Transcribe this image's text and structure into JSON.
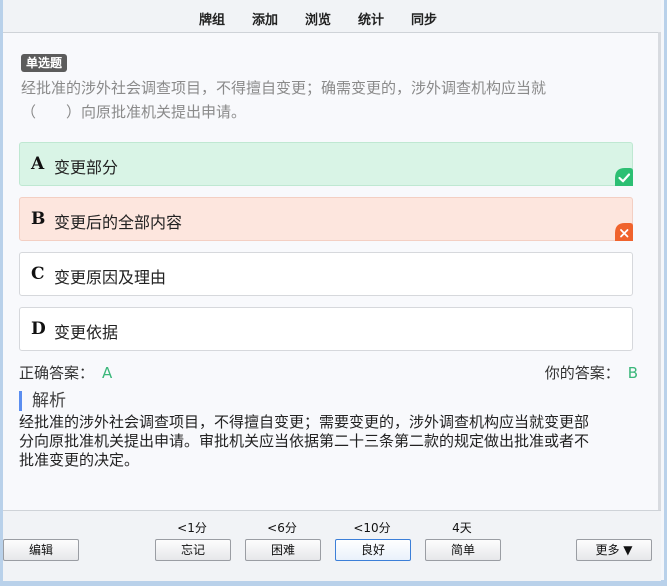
{
  "nav": {
    "tabs": [
      "牌组",
      "添加",
      "浏览",
      "统计",
      "同步"
    ]
  },
  "question": {
    "type_badge": "单选题",
    "line1": "经批准的涉外社会调查项目，不得擅自变更；确需变更的，涉外调查机构应当就",
    "line2": "（　　）向原批准机关提出申请。"
  },
  "options": [
    {
      "letter": "A",
      "text": "变更部分",
      "state": "correct"
    },
    {
      "letter": "B",
      "text": "变更后的全部内容",
      "state": "wrong"
    },
    {
      "letter": "C",
      "text": "变更原因及理由",
      "state": "normal"
    },
    {
      "letter": "D",
      "text": "变更依据",
      "state": "normal"
    }
  ],
  "answers": {
    "correct_label": "正确答案：",
    "correct_value": "A",
    "yours_label": "你的答案：",
    "yours_value": "B"
  },
  "analysis": {
    "heading": "解析",
    "line1": "经批准的涉外社会调查项目，不得擅自变更；需要变更的，涉外调查机构应当就变更部",
    "line2": "分向原批准机关提出申请。审批机关应当依据第二十三条第二款的规定做出批准或者不",
    "line3": "批准变更的决定。"
  },
  "bottom": {
    "edit_label": "编辑",
    "more_label": "更多 ▼",
    "intervals": [
      "<1分",
      "<6分",
      "<10分",
      "4天"
    ],
    "ease_buttons": [
      "忘记",
      "困难",
      "良好",
      "简单"
    ]
  },
  "colors": {
    "correct_bg": "#d9f4e6",
    "wrong_bg": "#fde6de",
    "correct_mark": "#2dbf73",
    "wrong_mark": "#f0632d",
    "accent": "#5b8ef0"
  }
}
